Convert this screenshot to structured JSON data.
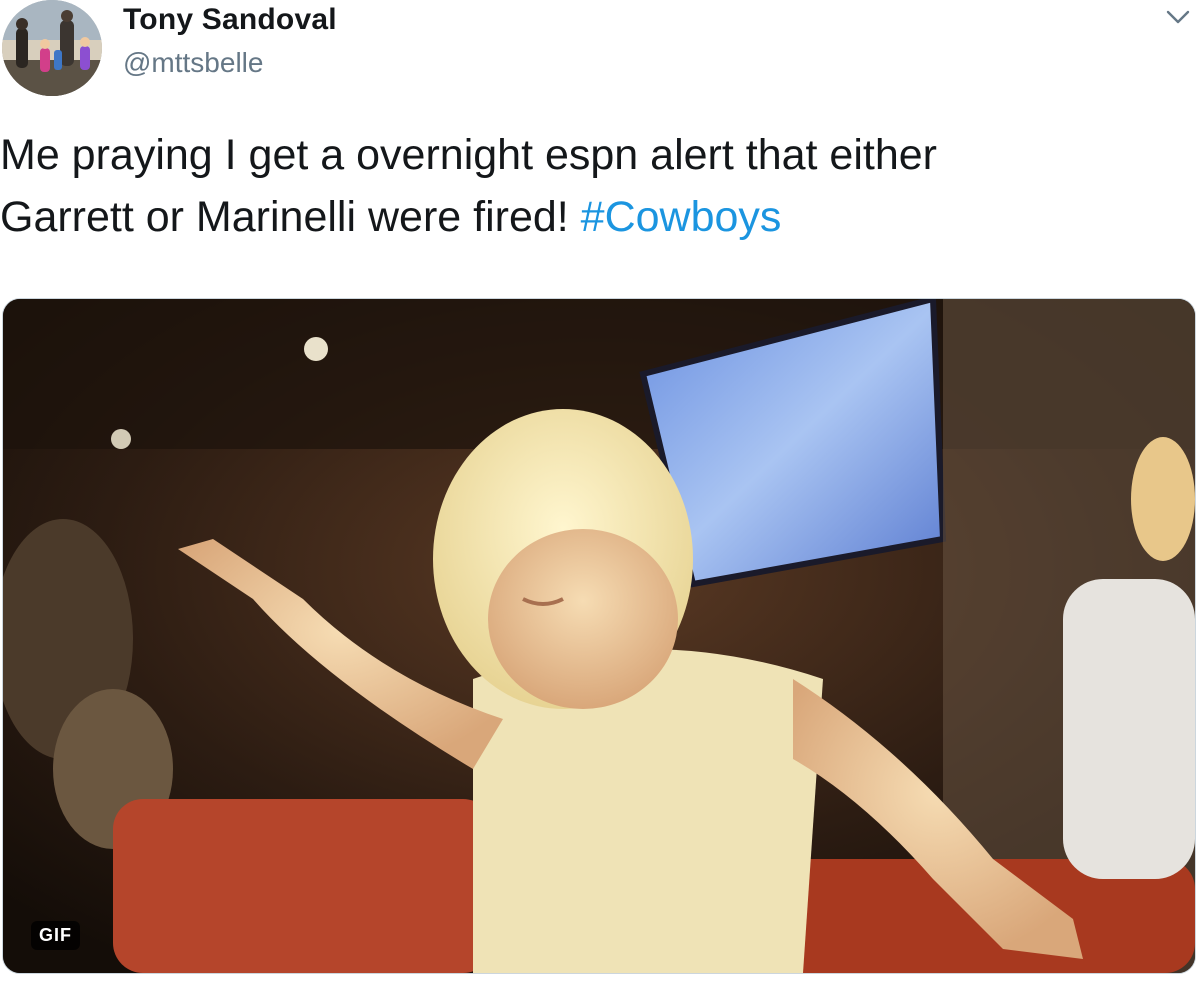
{
  "author": {
    "display_name": "Tony Sandoval",
    "handle": "@mttsbelle",
    "avatar_icon": "profile-photo"
  },
  "tweet": {
    "text_line1": "Me praying I get a overnight espn alert that either",
    "text_line2": "Garrett or Marinelli were fired! ",
    "hashtag": "#Cowboys",
    "hashtag_color": "#1b95e0"
  },
  "menu": {
    "icon": "chevron-down-icon"
  },
  "media": {
    "type": "gif",
    "badge": "GIF",
    "description_icon": "praying-child-gif"
  }
}
